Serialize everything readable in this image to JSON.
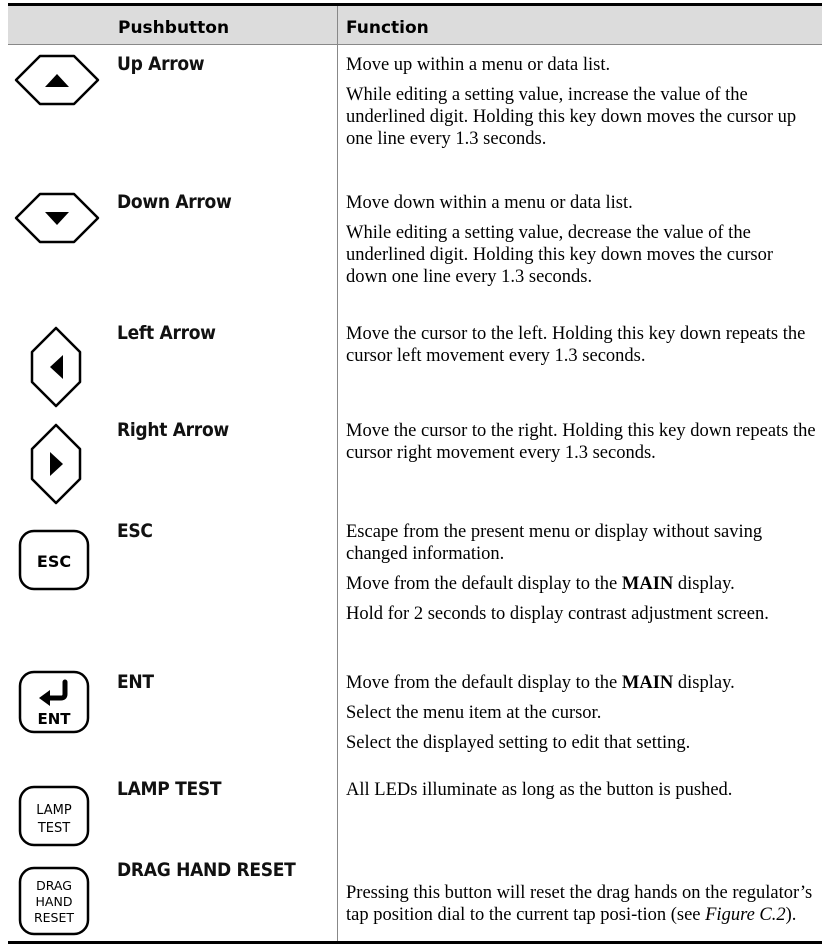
{
  "header": {
    "col1": "Pushbutton",
    "col2": "Function"
  },
  "rows": [
    {
      "name": "Up Arrow",
      "p1": "Move up within a menu or data list.",
      "p2": "While editing a setting value, increase the value of the underlined digit. Holding this key down moves the cursor up one line every 1.3 seconds."
    },
    {
      "name": "Down Arrow",
      "p1": "Move down within a menu or data list.",
      "p2": "While editing a setting value, decrease the value of the underlined digit. Holding this key down moves the cursor down one line every 1.3 seconds."
    },
    {
      "name": "Left Arrow",
      "p1": "Move the cursor to the left. Holding this key down repeats the cursor left movement every 1.3 seconds."
    },
    {
      "name": "Right Arrow",
      "p1": "Move the cursor to the right. Holding this key down repeats the cursor right movement every 1.3 seconds."
    },
    {
      "name": "ESC",
      "key_label": "ESC",
      "p1": "Escape from the present menu or display without saving changed information.",
      "p2_pre": "Move from the default display to the ",
      "p2_bold": "MAIN",
      "p2_post": " display.",
      "p3": "Hold for 2 seconds to display contrast adjustment screen."
    },
    {
      "name": "ENT",
      "key_label": "ENT",
      "p1_pre": "Move from the default display to the ",
      "p1_bold": "MAIN",
      "p1_post": " display.",
      "p2": "Select the menu item at the cursor.",
      "p3": "Select the displayed setting to edit that setting."
    },
    {
      "name": "LAMP TEST",
      "key_label_1": "LAMP",
      "key_label_2": "TEST",
      "p1": "All LEDs illuminate as long as the button is pushed."
    },
    {
      "name": "DRAG HAND RESET",
      "key_label_1": "DRAG",
      "key_label_2": "HAND",
      "key_label_3": "RESET",
      "p1_pre": "Pressing this button will reset the drag hands on the regulator’s tap position dial to the current tap posi-tion (see ",
      "p1_italic": "Figure C.2",
      "p1_post": ")."
    }
  ]
}
